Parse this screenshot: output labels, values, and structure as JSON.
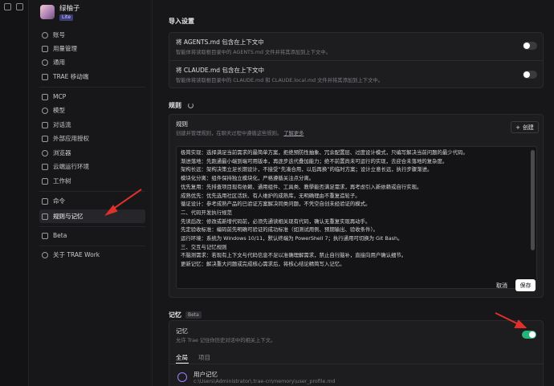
{
  "colors": {
    "accent_toggle": "#26b37a",
    "arrow": "#e0302a",
    "badge": "#3d3d7a"
  },
  "profile": {
    "name": "绿柚子",
    "plan": "Lite"
  },
  "sidebar": {
    "items": [
      {
        "label": "账号",
        "icon": "user-icon"
      },
      {
        "label": "用量管理",
        "icon": "usage-icon"
      },
      {
        "label": "通用",
        "icon": "gear-icon"
      },
      {
        "label": "TRAE 移动端",
        "icon": "mobile-icon"
      },
      {
        "label": "MCP",
        "icon": "mcp-icon"
      },
      {
        "label": "模型",
        "icon": "model-icon"
      },
      {
        "label": "对话流",
        "icon": "chat-flow-icon"
      },
      {
        "label": "外部应用授权",
        "icon": "external-app-icon"
      },
      {
        "label": "浏览器",
        "icon": "browser-icon"
      },
      {
        "label": "云端运行环境",
        "icon": "cloud-icon"
      },
      {
        "label": "工作树",
        "icon": "worktree-icon"
      },
      {
        "label": "命令",
        "icon": "command-icon"
      },
      {
        "label": "规则与记忆",
        "icon": "rules-memory-icon",
        "active": true
      },
      {
        "label": "Beta",
        "icon": "beta-icon"
      },
      {
        "label": "关于 TRAE Work",
        "icon": "info-icon"
      }
    ]
  },
  "import_settings": {
    "title": "导入设置",
    "agents": {
      "title": "将 AGENTS.md 包含在上下文中",
      "desc": "智能体将读取根目录中的 AGENTS.md 文件并将其添加到上下文中。",
      "enabled": false
    },
    "claude": {
      "title": "将 CLAUDE.md 包含在上下文中",
      "desc": "智能体将读取根目录中的 CLAUDE.md 和 CLAUDE.local.md 文件并将其添加到上下文中。",
      "enabled": false
    }
  },
  "rules": {
    "section_title": "规则",
    "card_title": "规则",
    "card_desc": "创建并管理规则，在聊天过程中遵循这些规则。",
    "learn_more": "了解更多",
    "create_label": "创建",
    "lines": [
      "极简实现：选择满足当前需求的最简单方案，拒绝预防性抽象、冗余配置层、过度设计模式，只编写解决当前问题的最少代码。",
      "渐进落地：先跑通最小端到端可用版本，再逐步迭代叠加能力；绝不前置尚未可运行的实现，去迎合未落地的复杂度。",
      "架构长远：架构决策立足长期设计，不接受“先凑合用，以后再换”的临时方案；设计立意长远，执行步骤渐进。",
      "模块化分离：组件保持独立模块化，严格遵循关注点分离。",
      "优先复用：先排查项目现有依赖、通用组件、工具类、教學能否满足需求，再考虑引入新依赖或自行实现。",
      "成熟优先：优先选用社区活跃、有人维护的成熟库，无明确理由不重复造轮子。",
      "循证设计：参考成熟产品的已验证方案解决同类问题，不凭空自创未经验证的模式。",
      "二、代码开发执行规范",
      "先读后改：修改或新增代码前，必须先通读相关现有代码，确认无重复实现再动手。",
      "先定验收标准：编码前先明确可验证的成功标准（如测试用例、预期输出、验收条件）。",
      "运行环境：系统为 Windows 10/11，默认终端为 PowerShell 7；执行通用可切换为 Git Bash。",
      "三、交互与记忆规则",
      "不脑测需求：若现有上下文与代码信息不足以准确理解需求，禁止自行脑补，直接向用户确认细节。",
      "更新记忆：解决重大问题或完成核心需求后，将核心结论精简写入记忆。"
    ],
    "cancel_label": "取消",
    "save_label": "保存"
  },
  "memory": {
    "section_title": "记忆",
    "beta": "Beta",
    "title": "记忆",
    "desc": "允许 Trae 记住你历史对话中的相关上下文。",
    "enabled": true,
    "tabs": [
      "全局",
      "项目"
    ],
    "user_memory": {
      "title": "用户记忆",
      "path": "c:\\Users\\Administrator\\.trae-cn\\memory\\user_profile.md"
    }
  }
}
